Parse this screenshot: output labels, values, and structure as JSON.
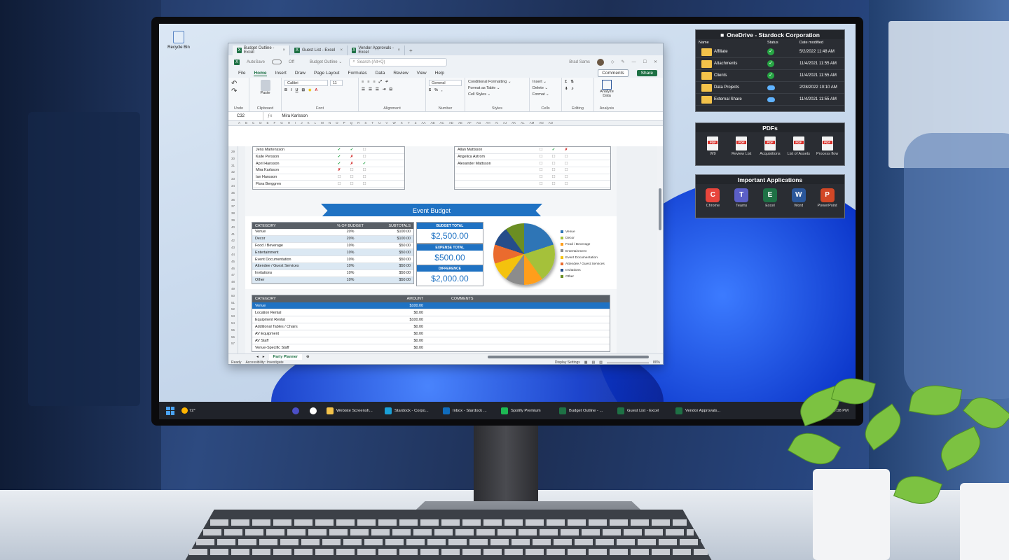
{
  "desktop": {
    "recycle_bin_label": "Recycle Bin"
  },
  "excel": {
    "tabs": [
      {
        "label": "Budget Outline - Excel"
      },
      {
        "label": "Guest List - Excel"
      },
      {
        "label": "Vendor Approvals - Excel"
      }
    ],
    "new_tab": "+",
    "autosave_label": "AutoSave",
    "autosave_state": "Off",
    "doc_title": "Budget Outline ⌄",
    "search_placeholder": "Search (Alt+Q)",
    "user_name": "Brad Sams",
    "menu": [
      "File",
      "Home",
      "Insert",
      "Draw",
      "Page Layout",
      "Formulas",
      "Data",
      "Review",
      "View",
      "Help"
    ],
    "comments_label": "Comments",
    "share_label": "Share",
    "ribbon": {
      "undo": "Undo",
      "clipboard": "Clipboard",
      "paste": "Paste",
      "font_name": "Calibri",
      "font_size": "11",
      "font": "Font",
      "alignment": "Alignment",
      "number_format": "General",
      "number": "Number",
      "conditional": "Conditional Formatting ⌄",
      "format_table": "Format as Table ⌄",
      "cell_styles": "Cell Styles ⌄",
      "styles": "Styles",
      "insert": "Insert ⌄",
      "delete": "Delete ⌄",
      "format": "Format ⌄",
      "cells": "Cells",
      "editing": "Editing",
      "analyze": "Analyze Data",
      "analysis": "Analysis"
    },
    "name_box": "C32",
    "formula_value": "Mira Karlsson",
    "columns": [
      "A",
      "B",
      "C",
      "D",
      "E",
      "F",
      "G",
      "H",
      "I",
      "J",
      "K",
      "L",
      "M",
      "N",
      "O",
      "P",
      "Q",
      "R",
      "S",
      "T",
      "U",
      "V",
      "W",
      "X",
      "Y",
      "Z",
      "AA",
      "AB",
      "AC",
      "AD",
      "AE",
      "AF",
      "AG",
      "AH",
      "AI",
      "AJ",
      "AK",
      "AL",
      "AM",
      "AN",
      "AO"
    ],
    "rows": [
      "29",
      "30",
      "31",
      "32",
      "33",
      "34",
      "35",
      "36",
      "37",
      "38",
      "39",
      "40",
      "41",
      "42",
      "43",
      "44",
      "45",
      "46",
      "47",
      "48",
      "49",
      "50",
      "51",
      "52",
      "53",
      "54",
      "55",
      "56",
      "57"
    ],
    "guests_left": [
      {
        "name": "Jens Martensson",
        "marks": [
          "✓",
          "✓",
          "☐"
        ]
      },
      {
        "name": "Kalle Persson",
        "marks": [
          "✓",
          "✗",
          "☐"
        ]
      },
      {
        "name": "April Hansson",
        "marks": [
          "✓",
          "✗",
          "✓"
        ]
      },
      {
        "name": "Mira Karlsson",
        "marks": [
          "✗",
          "☐",
          "☐"
        ]
      },
      {
        "name": "Ian Hansson",
        "marks": [
          "☐",
          "☐",
          "☐"
        ]
      },
      {
        "name": "Flora Berggren",
        "marks": [
          "☐",
          "☐",
          "☐"
        ]
      }
    ],
    "guests_right": [
      {
        "name": "Allan Mattsson",
        "marks": [
          "☐",
          "✓",
          "✗"
        ]
      },
      {
        "name": "Angelica Astrom",
        "marks": [
          "☐",
          "☐",
          "☐"
        ]
      },
      {
        "name": "Alexander Mattsson",
        "marks": [
          "☐",
          "☐",
          "☐"
        ]
      },
      {
        "name": "",
        "marks": [
          "☐",
          "☐",
          "☐"
        ]
      },
      {
        "name": "",
        "marks": [
          "☐",
          "☐",
          "☐"
        ]
      },
      {
        "name": "",
        "marks": [
          "☐",
          "☐",
          "☐"
        ]
      }
    ],
    "event_budget_title": "Event  Budget",
    "budget_headers": [
      "CATEGORY",
      "% OF BUDGET",
      "SUBTOTALS"
    ],
    "budget_rows": [
      {
        "category": "Venue",
        "pct": "20%",
        "subtotal": "$100.00"
      },
      {
        "category": "Decor",
        "pct": "20%",
        "subtotal": "$100.00"
      },
      {
        "category": "Food / Beverage",
        "pct": "10%",
        "subtotal": "$50.00"
      },
      {
        "category": "Entertainment",
        "pct": "10%",
        "subtotal": "$50.00"
      },
      {
        "category": "Event Documentation",
        "pct": "10%",
        "subtotal": "$50.00"
      },
      {
        "category": "Attendee / Guest Services",
        "pct": "10%",
        "subtotal": "$50.00"
      },
      {
        "category": "Invitations",
        "pct": "10%",
        "subtotal": "$50.00"
      },
      {
        "category": "Other",
        "pct": "10%",
        "subtotal": "$50.00"
      }
    ],
    "kpis": [
      {
        "label": "BUDGET TOTAL",
        "value": "$2,500.00"
      },
      {
        "label": "EXPENSE TOTAL",
        "value": "$500.00"
      },
      {
        "label": "DIFFERENCE",
        "value": "$2,000.00"
      }
    ],
    "pie_legend": [
      {
        "label": "Venue",
        "color": "#2e75b6"
      },
      {
        "label": "Decor",
        "color": "#a5c13a"
      },
      {
        "label": "Food / Beverage",
        "color": "#ff9e1b"
      },
      {
        "label": "Entertainment",
        "color": "#8c8c8c"
      },
      {
        "label": "Event Documentation",
        "color": "#f4c20d"
      },
      {
        "label": "Attendee / Guest Services",
        "color": "#ea6b2e"
      },
      {
        "label": "Invitations",
        "color": "#254d8a"
      },
      {
        "label": "Other",
        "color": "#6b8e23"
      }
    ],
    "detail_headers": [
      "CATEGORY",
      "AMOUNT",
      "COMMENTS"
    ],
    "detail_rows": [
      {
        "category": "Venue",
        "amount": "$100.00"
      },
      {
        "category": "Location Rental",
        "amount": "$0.00"
      },
      {
        "category": "Equipment Rental",
        "amount": "$100.00"
      },
      {
        "category": "Additional Tables / Chairs",
        "amount": "$0.00"
      },
      {
        "category": "AV Equipment",
        "amount": "$0.00"
      },
      {
        "category": "AV Staff",
        "amount": "$0.00"
      },
      {
        "category": "Venue-Specific Staff",
        "amount": "$0.00"
      }
    ],
    "sheet_tab": "Party Planner",
    "status_ready": "Ready",
    "accessibility": "Accessibility: Investigate",
    "display_settings": "Display Settings",
    "zoom": "80%"
  },
  "onedrive": {
    "title": "OneDrive - Stardock Corporation",
    "headers": [
      "Name",
      "Status",
      "Date modified"
    ],
    "rows": [
      {
        "name": "Affiliate",
        "status": "synced",
        "date": "5/2/2022 11:48 AM"
      },
      {
        "name": "Attachments",
        "status": "synced",
        "date": "11/4/2021 11:55 AM"
      },
      {
        "name": "Clients",
        "status": "synced",
        "date": "11/4/2021 11:55 AM"
      },
      {
        "name": "Data Projects",
        "status": "cloud",
        "date": "2/28/2022 10:10 AM"
      },
      {
        "name": "External Share",
        "status": "cloud",
        "date": "11/4/2021 11:55 AM"
      }
    ]
  },
  "pdfs": {
    "title": "PDFs",
    "items": [
      "W9",
      "Review List",
      "Acquisitions",
      "List of Assets",
      "Process flow"
    ]
  },
  "apps": {
    "title": "Important Applications",
    "items": [
      {
        "label": "Chrome",
        "icon": "chrome-icon",
        "color": "#e8453c"
      },
      {
        "label": "Teams",
        "icon": "teams-icon",
        "color": "#5b5fc7"
      },
      {
        "label": "Excel",
        "icon": "excel-icon",
        "color": "#1e7145"
      },
      {
        "label": "Word",
        "icon": "word-icon",
        "color": "#2b579a"
      },
      {
        "label": "PowerPoint",
        "icon": "powerpoint-icon",
        "color": "#d24726"
      }
    ]
  },
  "taskbar": {
    "weather": "72°",
    "items": [
      {
        "label": "Webiste Screensh...",
        "color": "#f3c24a"
      },
      {
        "label": "Stardock - Corpo...",
        "color": "#1aa0d8"
      },
      {
        "label": "Inbox - Stardock ...",
        "color": "#0f6cbd"
      },
      {
        "label": "Spotify Premium",
        "color": "#1db954"
      },
      {
        "label": "Budget Outline - ...",
        "color": "#1e7145"
      },
      {
        "label": "Guest List - Excel",
        "color": "#1e7145"
      },
      {
        "label": "Vendor Approvals...",
        "color": "#1e7145"
      }
    ],
    "clock": "3:08 PM"
  }
}
